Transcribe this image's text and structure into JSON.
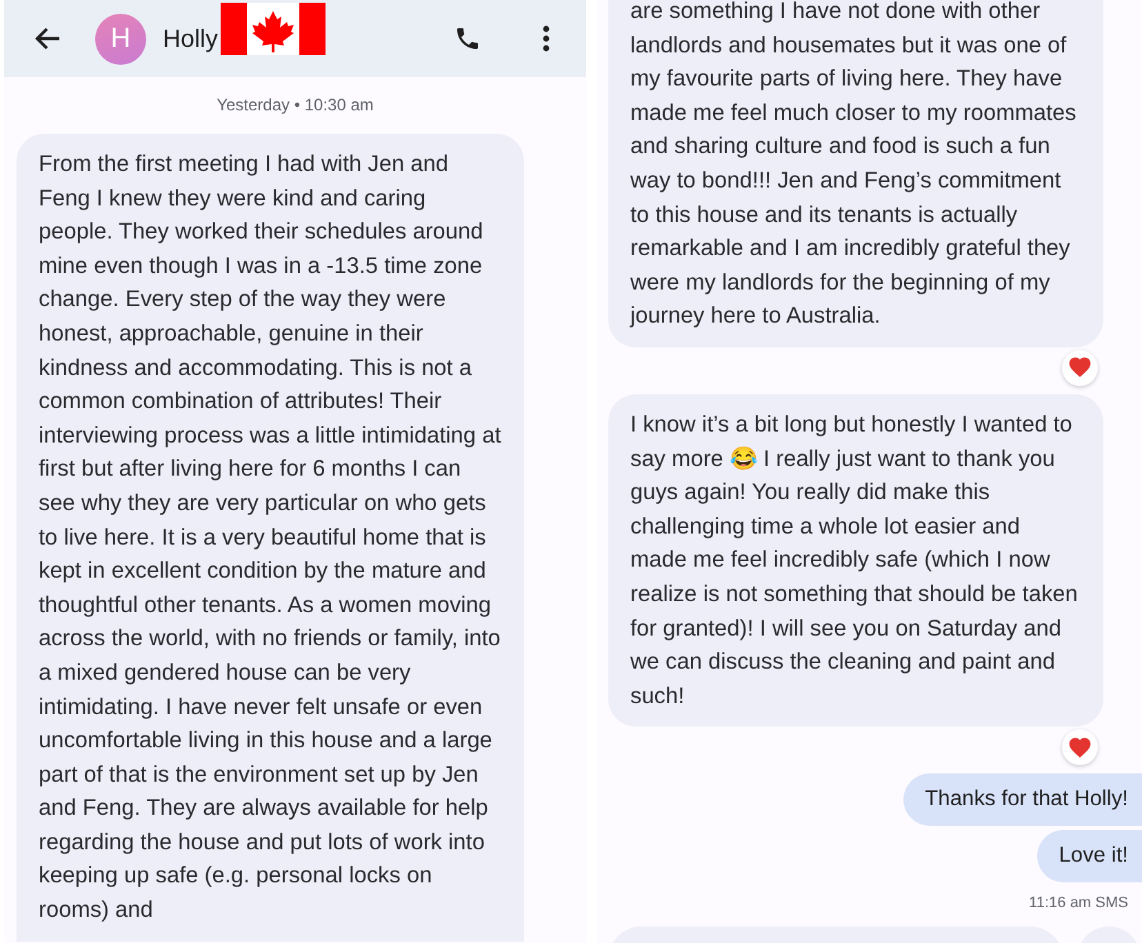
{
  "conversation": {
    "contact": "Holly",
    "avatar_letter": "H"
  },
  "left_panel": {
    "date": "Yesterday • 10:30 am",
    "messages": [
      {
        "kind": "incoming",
        "reaction": false,
        "text": "From the first meeting I had with Jen and Feng I knew they were kind and caring people. They worked their schedules around mine even though I was in a -13.5 time zone change. Every step of the way they were honest, approachable, genuine in their kindness and accommodating. This is not a common combination of attributes! Their interviewing process was a little intimidating at first but after living here for 6 months I can see why they are very particular on who gets to live here. It is a very beautiful home that is kept in excellent condition by the mature and thoughtful other tenants. As a women moving across the world, with no friends or family, into a mixed gendered house can be very intimidating. I have never felt unsafe or even uncomfortable living in this house and a large part of that is the environment set up by Jen and Feng. They are always available for help regarding the house and put lots of work into keeping up safe (e.g. personal locks on rooms) and"
      }
    ]
  },
  "right_panel": {
    "messages": [
      {
        "kind": "incoming",
        "reaction": true,
        "text": "are something I have not done with other landlords and housemates but it was one of my favourite parts of living here. They have made me feel much closer to my roommates and sharing culture and food is such a fun way to bond!!! Jen and Feng’s commitment to this house and its tenants is actually remarkable and I am incredibly grateful they were my landlords for the beginning of my journey here to Australia."
      },
      {
        "kind": "incoming",
        "reaction": true,
        "text": "I know it’s a bit long but honestly I wanted to say more 😂 I really just want to thank you guys again! You really did make this challenging time a whole lot easier and made me feel incredibly safe (which I now realize is not something that should be taken for granted)! I will see you on Saturday and we can discuss the cleaning and paint and such!"
      },
      {
        "kind": "outgoing",
        "reaction": false,
        "text": "Thanks for that Holly!"
      },
      {
        "kind": "outgoing",
        "reaction": false,
        "text": "Love it!"
      }
    ],
    "status": "11:16 am SMS"
  }
}
